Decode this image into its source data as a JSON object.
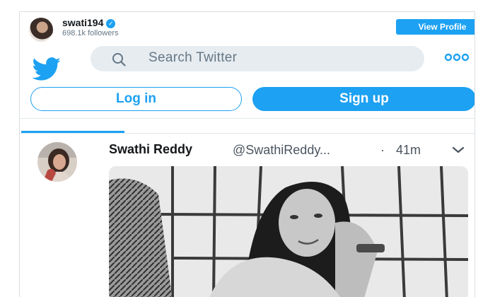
{
  "profile": {
    "username": "swati194",
    "followers": "698.1k followers",
    "view_profile_label": "View Profile"
  },
  "topbar": {
    "logo_icon": "twitter-bird-icon",
    "search_placeholder": "Search Twitter",
    "more_icon": "more-dots-icon"
  },
  "auth": {
    "login_label": "Log in",
    "signup_label": "Sign up"
  },
  "tweet": {
    "display_name": "Swathi Reddy",
    "handle": "@SwathiReddy...",
    "separator": "·",
    "time": "41m",
    "menu_icon": "chevron-down-icon",
    "media_icon": "photo"
  },
  "colors": {
    "accent": "#1da1f2",
    "search_bg": "#e6ecf0",
    "secondary_text": "#657786"
  }
}
